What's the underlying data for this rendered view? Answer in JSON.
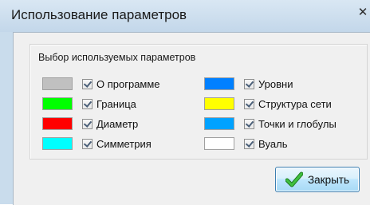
{
  "window": {
    "title": "Использование параметров",
    "close_glyph": "✕"
  },
  "group": {
    "label": "Выбор используемых параметров"
  },
  "parameters_left": [
    {
      "label": "О программе",
      "color": "#c0c0c0",
      "checked": true
    },
    {
      "label": "Граница",
      "color": "#00ff00",
      "checked": true
    },
    {
      "label": "Диаметр",
      "color": "#ff0000",
      "checked": true
    },
    {
      "label": "Симметрия",
      "color": "#00ffff",
      "checked": true
    }
  ],
  "parameters_right": [
    {
      "label": "Уровни",
      "color": "#0080ff",
      "checked": true
    },
    {
      "label": "Структура сети",
      "color": "#ffff00",
      "checked": true
    },
    {
      "label": "Точки и глобулы",
      "color": "#00a2ff",
      "checked": true
    },
    {
      "label": "Вуаль",
      "color": "#ffffff",
      "checked": true
    }
  ],
  "close_button": {
    "label": "Закрыть",
    "icon": "green-checkmark-icon"
  }
}
